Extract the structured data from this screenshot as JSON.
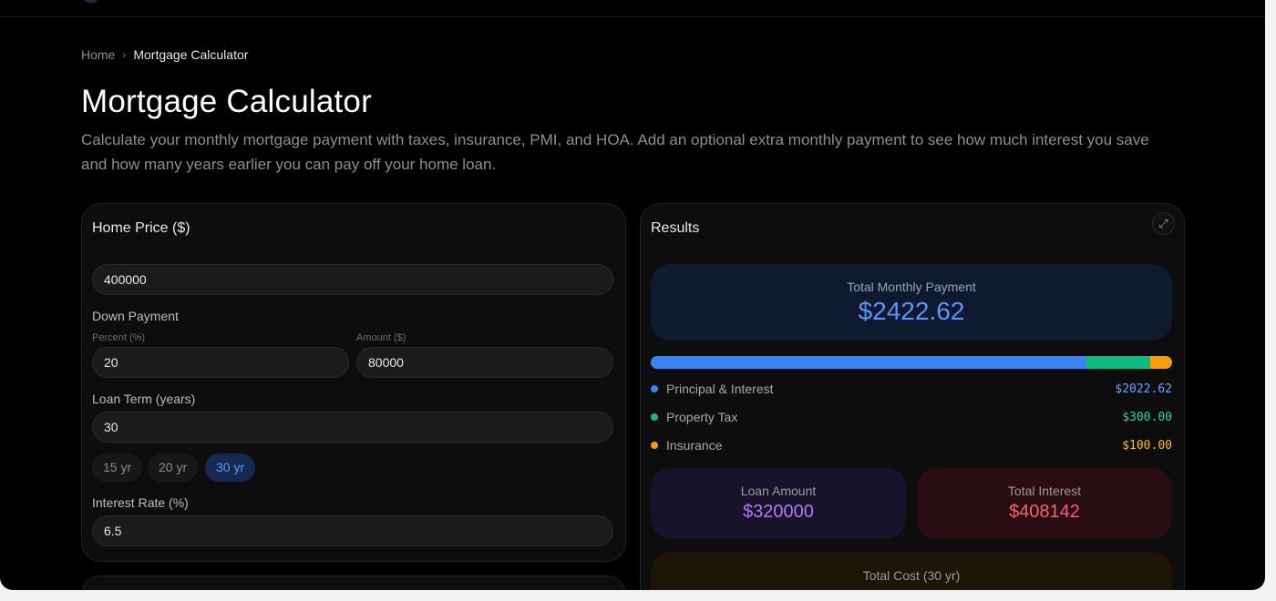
{
  "breadcrumb": {
    "home": "Home",
    "separator": "›",
    "current": "Mortgage Calculator"
  },
  "page": {
    "title": "Mortgage Calculator",
    "description": "Calculate your monthly mortgage payment with taxes, insurance, PMI, and HOA. Add an optional extra monthly payment to see how much interest you save and how many years earlier you can pay off your home loan."
  },
  "form": {
    "home_price_label": "Home Price ($)",
    "home_price_value": "400000",
    "down_payment_label": "Down Payment",
    "percent_label": "Percent (%)",
    "percent_value": "20",
    "amount_label": "Amount ($)",
    "amount_value": "80000",
    "loan_term_label": "Loan Term (years)",
    "loan_term_value": "30",
    "term_chips": [
      "15 yr",
      "20 yr",
      "30 yr"
    ],
    "active_chip": "30 yr",
    "interest_rate_label": "Interest Rate (%)",
    "interest_rate_value": "6.5"
  },
  "results": {
    "title": "Results",
    "expand_icon": "expand-icon",
    "total_label": "Total Monthly Payment",
    "total_value": "$2422.62",
    "breakdown": [
      {
        "label": "Principal & Interest",
        "value": "$2022.62",
        "amount": 2022.62,
        "color": "#3b82f6"
      },
      {
        "label": "Property Tax",
        "value": "$300.00",
        "amount": 300.0,
        "color": "#10b981"
      },
      {
        "label": "Insurance",
        "value": "$100.00",
        "amount": 100.0,
        "color": "#f59e0b"
      }
    ],
    "loan_amount_label": "Loan Amount",
    "loan_amount_value": "$320000",
    "total_interest_label": "Total Interest",
    "total_interest_value": "$408142",
    "total_cost_label": "Total Cost (30 yr)"
  },
  "colors": {
    "accent": "#5b93ff",
    "loan_amount": "#b07cf5",
    "total_interest": "#ff5c76"
  }
}
